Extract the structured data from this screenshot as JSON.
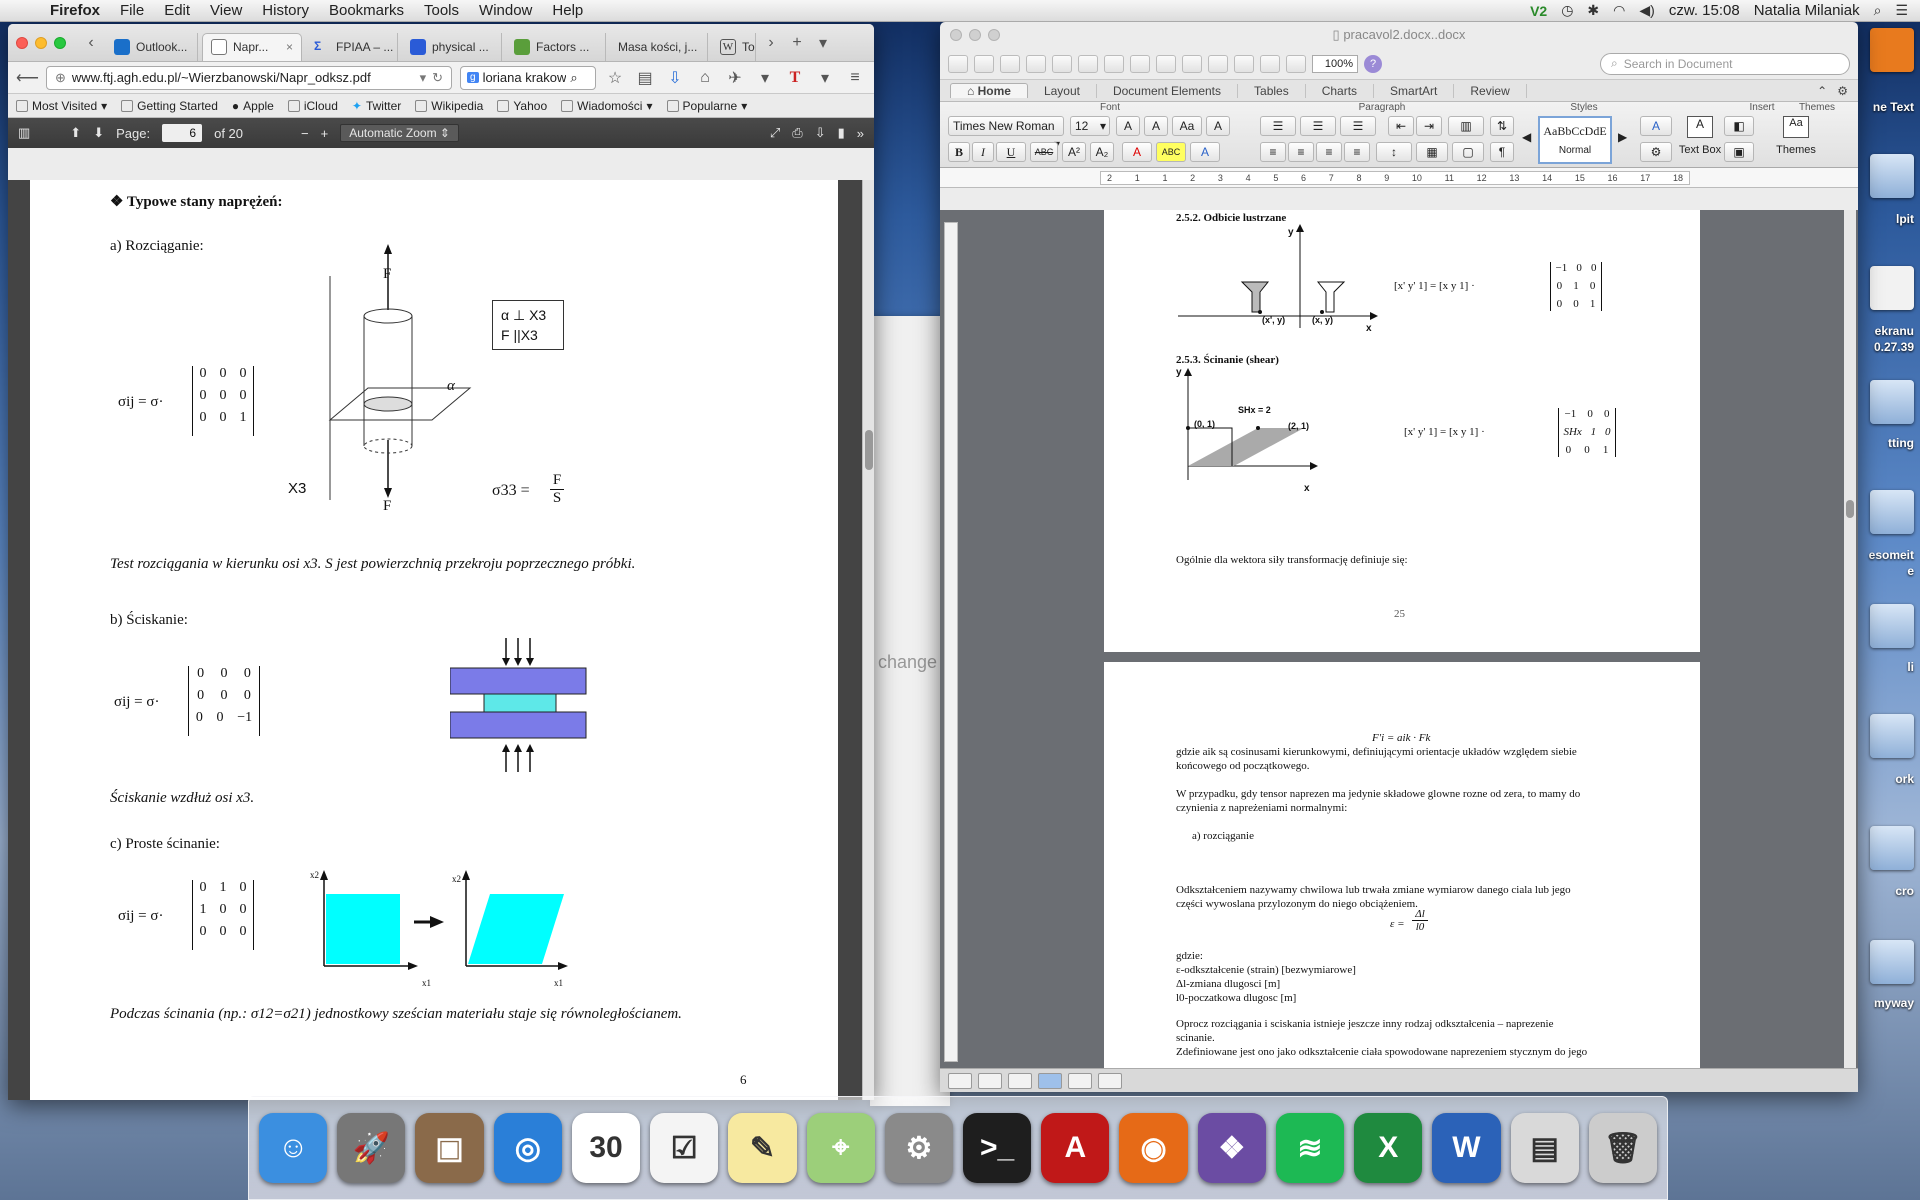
{
  "menubar": {
    "app": "Firefox",
    "items": [
      "File",
      "Edit",
      "View",
      "History",
      "Bookmarks",
      "Tools",
      "Window",
      "Help"
    ],
    "clock": "czw. 15:08",
    "user": "Natalia Milaniak"
  },
  "desktop": {
    "labels": [
      "ne Text",
      "lpit",
      "ekranu",
      "0.27.39",
      "tting",
      "esomeit",
      "e",
      "li",
      "ork",
      "cro",
      "myway"
    ],
    "bg_label": "change"
  },
  "firefox": {
    "tabs": [
      {
        "label": "Outlook...",
        "fav_color": "#1a6fc9"
      },
      {
        "label": "Napr...",
        "fav_color": "#777777"
      },
      {
        "label": "FPIAA – ...",
        "fav_color": "#2a5bd7"
      },
      {
        "label": "physical ...",
        "fav_color": "#2a5bd7"
      },
      {
        "label": "Factors ...",
        "fav_color": "#5a9e3b"
      },
      {
        "label": "Masa kości, j...",
        "fav_color": "#999999"
      },
      {
        "label": "To",
        "fav_color": "#333333"
      }
    ],
    "url": "www.ftj.agh.edu.pl/~Wierzbanowski/Napr_odksz.pdf",
    "search_value": "loriana krakow",
    "bookmarks": [
      "Most Visited",
      "Getting Started",
      "Apple",
      "iCloud",
      "Twitter",
      "Wikipedia",
      "Yahoo",
      "Wiadomości",
      "Popularne"
    ],
    "pdf": {
      "page_label": "Page:",
      "page_current": "6",
      "page_total": "of 20",
      "zoom": "Automatic Zoom"
    }
  },
  "pdf_content": {
    "heading": "❖  Typowe stany naprężeń:",
    "sec_a": "a)   Rozciąganie:",
    "sigma_lhs": "σij = σ·",
    "matrix_a": [
      [
        "0",
        "0",
        "0"
      ],
      [
        "0",
        "0",
        "0"
      ],
      [
        "0",
        "0",
        "1"
      ]
    ],
    "box_line1": "α ⊥ X3",
    "box_line2": "F  ||X3",
    "force_label": "F",
    "alpha_label": "α",
    "x3_label": "X3",
    "sigma33": "σ33 =",
    "frac_num": "F",
    "frac_den": "S",
    "caption_a": "Test rozciągania w kierunku osi x3. S jest powierzchnią przekroju poprzecznego próbki.",
    "sec_b": "b)   Ściskanie:",
    "matrix_b": [
      [
        "0",
        "0",
        "0"
      ],
      [
        "0",
        "0",
        "0"
      ],
      [
        "0",
        "0",
        "−1"
      ]
    ],
    "caption_b": "Ściskanie wzdłuż osi x3.",
    "sec_c": "c)   Proste ścinanie:",
    "matrix_c": [
      [
        "0",
        "1",
        "0"
      ],
      [
        "1",
        "0",
        "0"
      ],
      [
        "0",
        "0",
        "0"
      ]
    ],
    "axis_x2": "x2",
    "axis_x1": "x1",
    "caption_c": "Podczas ścinania (np.: σ12=σ21) jednostkowy sześcian materiału staje się równoległościanem.",
    "page_num": "6"
  },
  "word": {
    "title": "pracavol2.docx..docx",
    "zoom": "100%",
    "search_placeholder": "Search in Document",
    "ribbon_tabs": [
      "Home",
      "Layout",
      "Document Elements",
      "Tables",
      "Charts",
      "SmartArt",
      "Review"
    ],
    "groups": [
      "Font",
      "Paragraph",
      "Styles",
      "Insert",
      "Themes"
    ],
    "font_name": "Times New Roman",
    "font_size": "12",
    "style_preview": "AaBbCcDdE",
    "style_name": "Normal",
    "textbox_label": "Text Box",
    "themes_label": "Themes",
    "ruler_marks": [
      "2",
      "1",
      "1",
      "2",
      "3",
      "4",
      "5",
      "6",
      "7",
      "8",
      "9",
      "10",
      "11",
      "12",
      "13",
      "14",
      "15",
      "16",
      "17",
      "18"
    ]
  },
  "word_page1": {
    "h252": "2.5.2. Odbicie lustrzane",
    "y": "y",
    "x": "x",
    "pt_a": "(x', y)",
    "pt_b": "(x, y)",
    "eq1": "[x'   y'   1] = [x   y   1] ·",
    "m1": [
      [
        "−1",
        "0",
        "0"
      ],
      [
        "0",
        "1",
        "0"
      ],
      [
        "0",
        "0",
        "1"
      ]
    ],
    "h253": "2.5.3. Ścinanie (shear)",
    "shx": "SHx = 2",
    "p01": "(0, 1)",
    "p21": "(2, 1)",
    "eq2": "[x'   y'   1] = [x   y   1] ·",
    "m2": [
      [
        "−1",
        "0",
        "0"
      ],
      [
        "SHx",
        "1",
        "0"
      ],
      [
        "0",
        "0",
        "1"
      ]
    ],
    "para": "Ogólnie dla wektora siły transformację definiuje się:",
    "page_num": "25"
  },
  "word_page2": {
    "formula": "F'i = aik · Fk",
    "l1": "gdzie aik są cosinusami kierunkowymi, definiującymi orientacje układów względem siebie",
    "l2": "końcowego od początkowego.",
    "l3": "W przypadku, gdy tensor naprezen ma jedynie składowe glowne rozne od zera, to mamy do",
    "l4": "czynienia z napreżeniami normalnymi:",
    "l5": "a)   rozciąganie",
    "l6": "Odkształceniem nazywamy chwilowa lub trwała zmiane wymiarow danego ciala lub jego",
    "l7": "części wywoslana przylozonym do niego obciążeniem.",
    "eps": "ε =",
    "eps_num": "Δl",
    "eps_den": "l0",
    "l8": "gdzie:",
    "l9": "ε-odkształcenie (strain) [bezwymiarowe]",
    "l10": "Δl-zmiana dlugosci [m]",
    "l11": "l0-poczatkowa dlugosc [m]",
    "l12": "Oprocz rozciągania i sciskania istnieje jeszcze inny rodzaj odkształcenia – naprezenie",
    "l13": "scinanie.",
    "l14": "Zdefiniowane jest ono jako odkształcenie ciała spowodowane naprezeniem stycznym do jego"
  },
  "dock": {
    "apps": [
      {
        "name": "finder",
        "color": "#3b8fe0",
        "glyph": "☺"
      },
      {
        "name": "launchpad",
        "color": "#777777",
        "glyph": "🚀"
      },
      {
        "name": "photos",
        "color": "#8a6a4a",
        "glyph": "▣"
      },
      {
        "name": "safari",
        "color": "#2a7fd8",
        "glyph": "◎"
      },
      {
        "name": "calendar",
        "color": "#ffffff",
        "glyph": "30"
      },
      {
        "name": "reminders",
        "color": "#f4f4f4",
        "glyph": "☑"
      },
      {
        "name": "notes",
        "color": "#f7e9a0",
        "glyph": "✎"
      },
      {
        "name": "maps",
        "color": "#9ccf7a",
        "glyph": "⌖"
      },
      {
        "name": "system-preferences",
        "color": "#8a8a8a",
        "glyph": "⚙"
      },
      {
        "name": "terminal",
        "color": "#1e1e1e",
        "glyph": ">_"
      },
      {
        "name": "acrobat",
        "color": "#c01818",
        "glyph": "A"
      },
      {
        "name": "firefox",
        "color": "#e66a17",
        "glyph": "◉"
      },
      {
        "name": "github",
        "color": "#6b4ca3",
        "glyph": "❖"
      },
      {
        "name": "spotify",
        "color": "#1db954",
        "glyph": "≋"
      },
      {
        "name": "excel",
        "color": "#1f8a3f",
        "glyph": "X"
      },
      {
        "name": "word",
        "color": "#2b62b8",
        "glyph": "W"
      },
      {
        "name": "downloads",
        "color": "#d9d9d9",
        "glyph": "▤"
      },
      {
        "name": "trash",
        "color": "#cccccc",
        "glyph": "🗑"
      }
    ]
  }
}
